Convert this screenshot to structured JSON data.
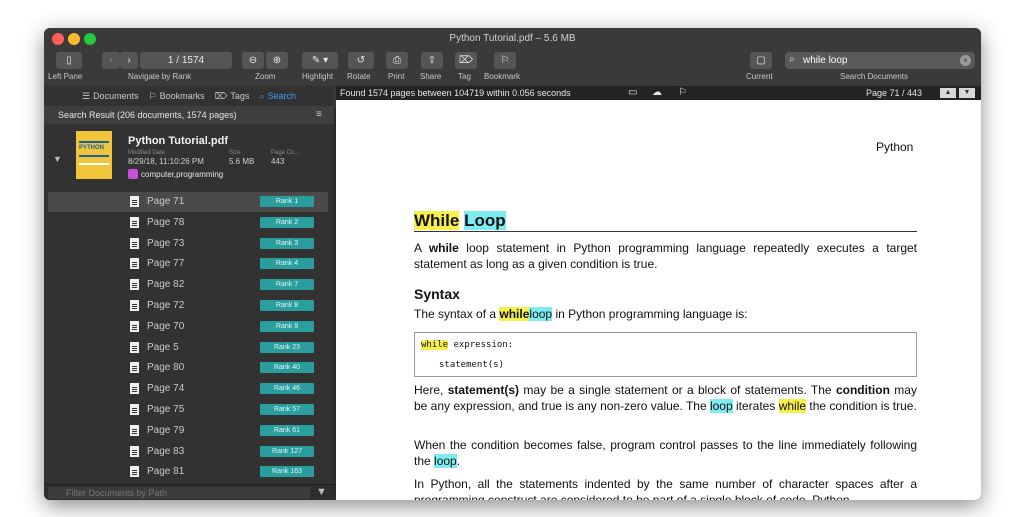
{
  "window": {
    "title": "Python Tutorial.pdf – 5.6 MB"
  },
  "toolbar": {
    "left_pane": "Left Pane",
    "navigate": "Navigate by Rank",
    "page_counter": "1 / 1574",
    "zoom": "Zoom",
    "highlight": "Highlight",
    "rotate": "Rotate",
    "print": "Print",
    "share": "Share",
    "tag": "Tag",
    "bookmark": "Bookmark",
    "current": "Current",
    "search_documents": "Search Documents",
    "search_value": "while loop"
  },
  "sidebar": {
    "tabs": [
      {
        "label": "Documents",
        "icon": "list-icon"
      },
      {
        "label": "Bookmarks",
        "icon": "bookmark-icon"
      },
      {
        "label": "Tags",
        "icon": "tag-icon"
      },
      {
        "label": "Search",
        "icon": "search-icon"
      }
    ],
    "result_summary": "Search Result (206 documents, 1574 pages)",
    "document": {
      "title": "Python Tutorial.pdf",
      "modified_label": "Modified Date",
      "modified_value": "8/29/18, 11:10:26 PM",
      "size_label": "Size",
      "size_value": "5.6 MB",
      "page_count_label": "Page Co...",
      "page_count_value": "443",
      "tags": "computer,programming",
      "thumb_text": "PYTHON"
    },
    "pages": [
      {
        "label": "Page 71",
        "rank": "Rank 1"
      },
      {
        "label": "Page 78",
        "rank": "Rank 2"
      },
      {
        "label": "Page 73",
        "rank": "Rank 3"
      },
      {
        "label": "Page 77",
        "rank": "Rank 4"
      },
      {
        "label": "Page 82",
        "rank": "Rank 7"
      },
      {
        "label": "Page 72",
        "rank": "Rank 8"
      },
      {
        "label": "Page 70",
        "rank": "Rank 9"
      },
      {
        "label": "Page 5",
        "rank": "Rank 23"
      },
      {
        "label": "Page 80",
        "rank": "Rank 40"
      },
      {
        "label": "Page 74",
        "rank": "Rank 46"
      },
      {
        "label": "Page 75",
        "rank": "Rank 57"
      },
      {
        "label": "Page 79",
        "rank": "Rank 61"
      },
      {
        "label": "Page 83",
        "rank": "Rank 127"
      },
      {
        "label": "Page 81",
        "rank": "Rank 163"
      }
    ],
    "filter_placeholder": "Filter Documents by Path"
  },
  "viewer": {
    "info": "Found 1574 pages between 104719 within 0.056 seconds",
    "page_indicator": "Page 71 / 443",
    "header": "Python",
    "heading_while": "While",
    "heading_loop": "Loop",
    "p1_a": "A",
    "p1_while": "while",
    "p1_b": "loop statement in Python programming language repeatedly executes a target statement as long as a given condition is true.",
    "syntax_heading": "Syntax",
    "p2_a": "The syntax of a",
    "p2_while": "while",
    "p2_loop": "loop",
    "p2_b": "in Python programming language is:",
    "code_kw": "while",
    "code_rest": " expression:",
    "code_line2": "statement(s)",
    "p3_a": "Here,",
    "p3_b": "statement(s)",
    "p3_c": "may be a single statement or a block of statements. The",
    "p3_d": "condition",
    "p3_e": "may be any expression, and true is any non-zero value. The",
    "p3_loop": "loop",
    "p3_f": "iterates",
    "p3_while": "while",
    "p3_g": "the condition is true.",
    "p4_a": "When the condition becomes false, program control passes to the line immediately following the",
    "p4_loop": "loop",
    "p4_b": ".",
    "p5": "In Python, all the statements indented by the same number of character spaces after a programming construct are considered to be part of a single block of code. Python"
  }
}
